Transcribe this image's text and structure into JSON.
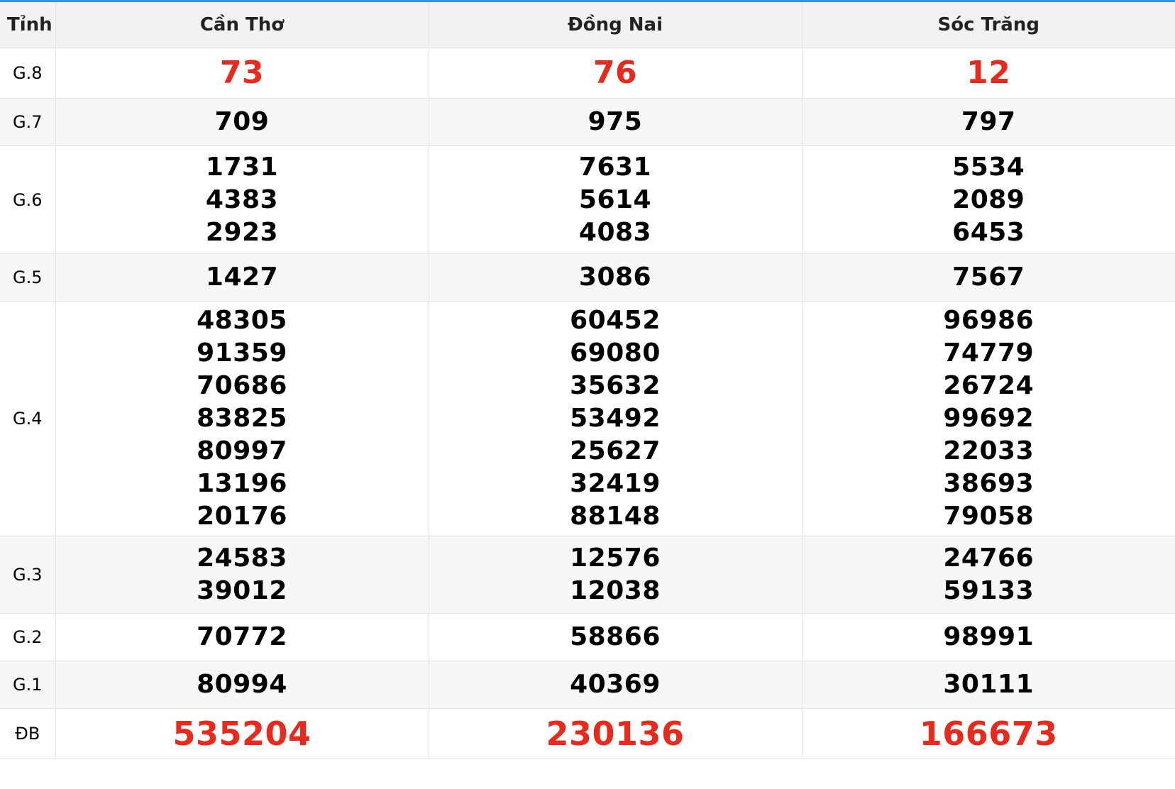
{
  "header": {
    "label": "Tỉnh",
    "provinces": [
      "Cần Thơ",
      "Đồng Nai",
      "Sóc Trăng"
    ]
  },
  "prizes": {
    "g8": {
      "label": "G.8",
      "values": [
        [
          "73"
        ],
        [
          "76"
        ],
        [
          "12"
        ]
      ]
    },
    "g7": {
      "label": "G.7",
      "values": [
        [
          "709"
        ],
        [
          "975"
        ],
        [
          "797"
        ]
      ]
    },
    "g6": {
      "label": "G.6",
      "values": [
        [
          "1731",
          "4383",
          "2923"
        ],
        [
          "7631",
          "5614",
          "4083"
        ],
        [
          "5534",
          "2089",
          "6453"
        ]
      ]
    },
    "g5": {
      "label": "G.5",
      "values": [
        [
          "1427"
        ],
        [
          "3086"
        ],
        [
          "7567"
        ]
      ]
    },
    "g4": {
      "label": "G.4",
      "values": [
        [
          "48305",
          "91359",
          "70686",
          "83825",
          "80997",
          "13196",
          "20176"
        ],
        [
          "60452",
          "69080",
          "35632",
          "53492",
          "25627",
          "32419",
          "88148"
        ],
        [
          "96986",
          "74779",
          "26724",
          "99692",
          "22033",
          "38693",
          "79058"
        ]
      ]
    },
    "g3": {
      "label": "G.3",
      "values": [
        [
          "24583",
          "39012"
        ],
        [
          "12576",
          "12038"
        ],
        [
          "24766",
          "59133"
        ]
      ]
    },
    "g2": {
      "label": "G.2",
      "values": [
        [
          "70772"
        ],
        [
          "58866"
        ],
        [
          "98991"
        ]
      ]
    },
    "g1": {
      "label": "G.1",
      "values": [
        [
          "80994"
        ],
        [
          "40369"
        ],
        [
          "30111"
        ]
      ]
    },
    "db": {
      "label": "ĐB",
      "values": [
        [
          "535204"
        ],
        [
          "230136"
        ],
        [
          "166673"
        ]
      ]
    }
  },
  "colors": {
    "accent_line": "#3a8ee6",
    "highlight_red": "#e8291c"
  }
}
